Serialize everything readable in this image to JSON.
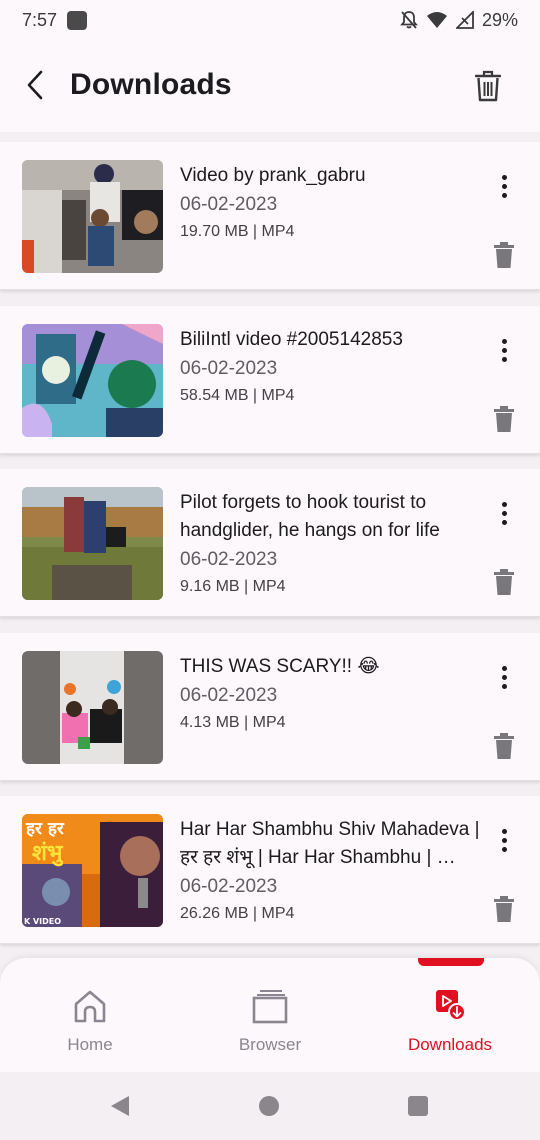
{
  "status_bar": {
    "time": "7:57",
    "battery": "29%"
  },
  "header": {
    "title": "Downloads"
  },
  "videos": [
    {
      "title": "Video by prank_gabru",
      "date": "06-02-2023",
      "meta": "19.70 MB | MP4"
    },
    {
      "title": "BiliIntl video #2005142853",
      "date": "06-02-2023",
      "meta": "58.54 MB | MP4"
    },
    {
      "title": "Pilot forgets to hook tourist to handglider, he hangs on for life",
      "date": "06-02-2023",
      "meta": "9.16 MB | MP4"
    },
    {
      "title": "THIS WAS SCARY!! 😂",
      "date": "06-02-2023",
      "meta": "4.13 MB | MP4"
    },
    {
      "title": "Har Har Shambhu Shiv Mahadeva | हर हर शंभू | Har Har Shambhu | …",
      "date": "06-02-2023",
      "meta": "26.26 MB | MP4"
    }
  ],
  "thumb_text": {
    "video5_line1": "हर हर",
    "video5_line2": "शंभु",
    "video5_corner": "K VIDEO"
  },
  "bottom_nav": {
    "items": [
      {
        "label": "Home",
        "icon": "home-icon"
      },
      {
        "label": "Browser",
        "icon": "browser-icon"
      },
      {
        "label": "Downloads",
        "icon": "downloads-icon"
      }
    ],
    "active": "Downloads"
  },
  "colors": {
    "accent": "#e01020",
    "background": "#fdf8fc",
    "muted": "#8a8690"
  }
}
